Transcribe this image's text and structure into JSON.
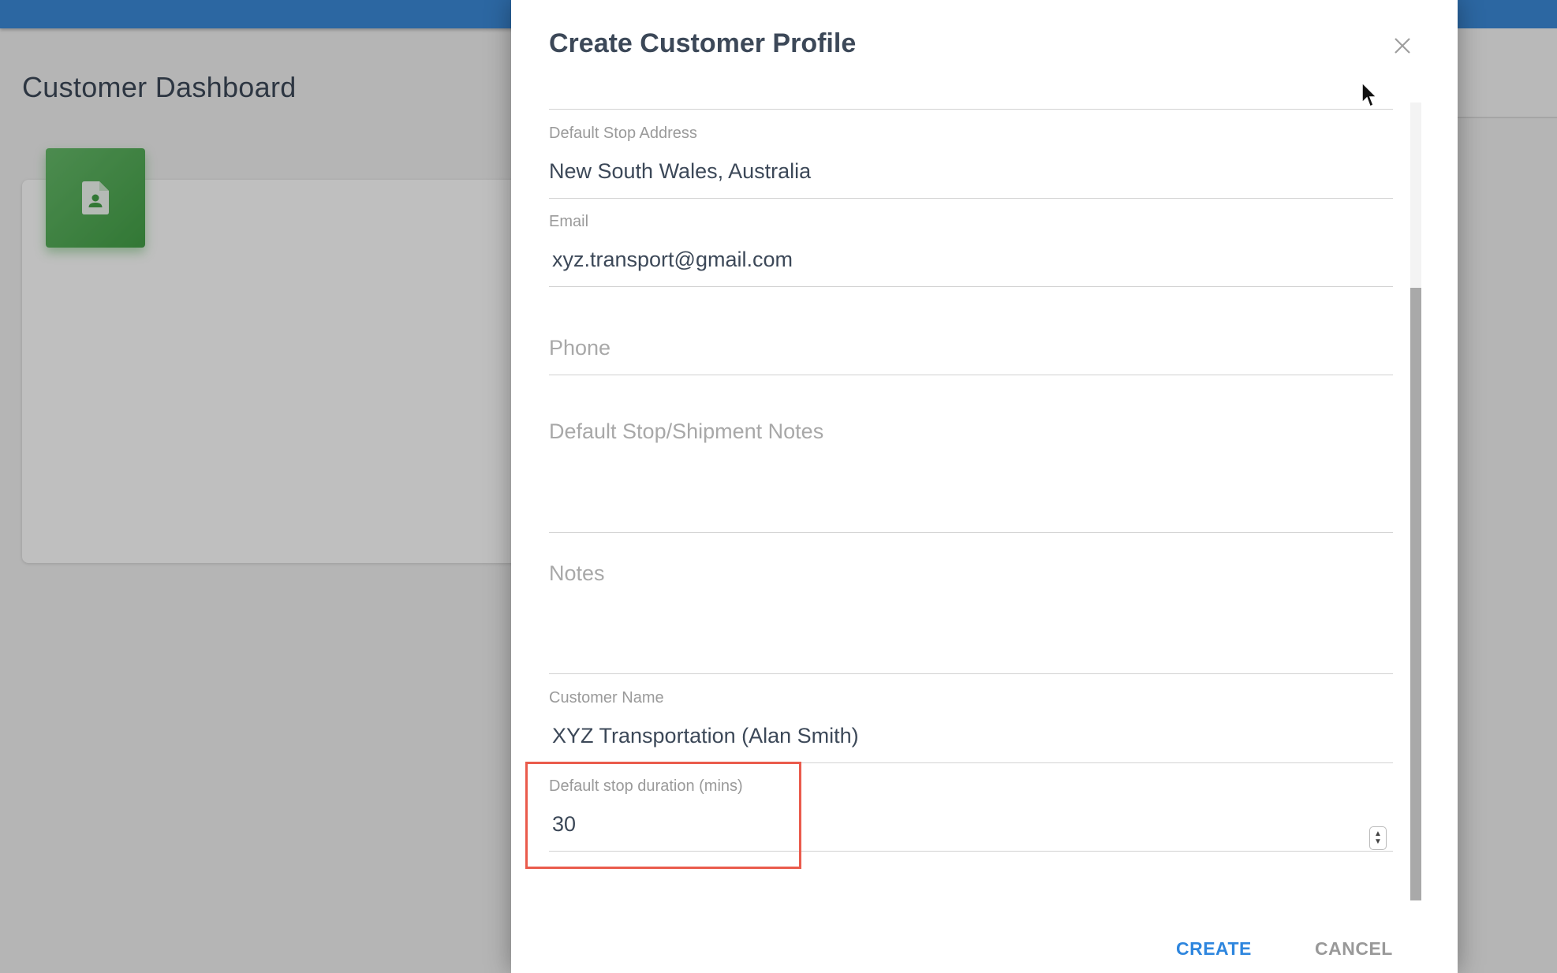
{
  "page": {
    "title": "Customer Dashboard"
  },
  "modal": {
    "title": "Create Customer Profile",
    "close_icon": "close-icon",
    "fields": {
      "address": {
        "label": "Default Stop Address",
        "value": "New South Wales, Australia"
      },
      "email": {
        "label": "Email",
        "value": "xyz.transport@gmail.com"
      },
      "phone": {
        "placeholder": "Phone"
      },
      "stop_notes": {
        "placeholder": "Default Stop/Shipment Notes"
      },
      "notes": {
        "placeholder": "Notes"
      },
      "customer_name": {
        "label": "Customer Name",
        "value": "XYZ Transportation (Alan Smith)"
      },
      "stop_duration": {
        "label": "Default stop duration (mins)",
        "value": "30"
      }
    },
    "actions": {
      "create_label": "CREATE",
      "cancel_label": "CANCEL"
    }
  },
  "colors": {
    "topbar": "#3b8ad9",
    "card_icon": "#4caf50",
    "create_button": "#2e86de",
    "highlight": "#ea5b4c"
  }
}
